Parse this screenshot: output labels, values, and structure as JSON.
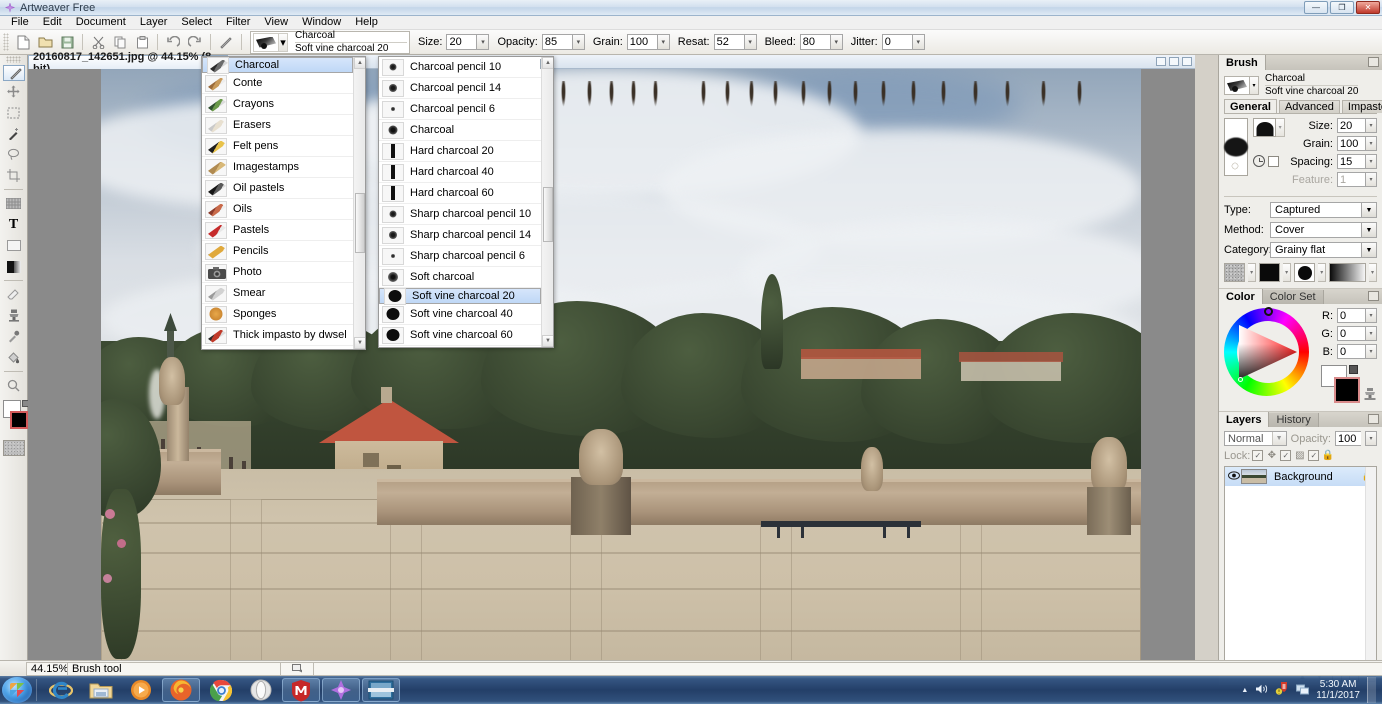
{
  "window": {
    "title": "Artweaver Free",
    "app_icon": "artweaver-icon",
    "minimize": "—",
    "maximize": "❐",
    "close": "✕"
  },
  "menubar": {
    "items": [
      "File",
      "Edit",
      "Document",
      "Layer",
      "Select",
      "Filter",
      "View",
      "Window",
      "Help"
    ]
  },
  "toolbar": {
    "buttons": [
      {
        "name": "new-document-button",
        "glyph": "🗋"
      },
      {
        "name": "open-document-button",
        "glyph": "🗁"
      },
      {
        "name": "save-document-button",
        "glyph": "🖫"
      },
      {
        "name": "cut-button",
        "glyph": "✂"
      },
      {
        "name": "copy-button",
        "glyph": "🗐"
      },
      {
        "name": "paste-button",
        "glyph": "📋"
      },
      {
        "name": "undo-button",
        "glyph": "↺"
      },
      {
        "name": "redo-button",
        "glyph": "↻"
      },
      {
        "name": "brush-tool-button",
        "glyph": "/"
      }
    ],
    "brush_preview": {
      "category": "Charcoal",
      "variant": "Soft vine charcoal 20"
    },
    "params": [
      {
        "label": "Size:",
        "value": "20",
        "name": "size-param"
      },
      {
        "label": "Opacity:",
        "value": "85",
        "name": "opacity-param"
      },
      {
        "label": "Grain:",
        "value": "100",
        "name": "grain-param"
      },
      {
        "label": "Resat:",
        "value": "52",
        "name": "resat-param"
      },
      {
        "label": "Bleed:",
        "value": "80",
        "name": "bleed-param"
      },
      {
        "label": "Jitter:",
        "value": "0",
        "name": "jitter-param"
      }
    ]
  },
  "tools": [
    {
      "name": "brush-tool",
      "glyph": "✎",
      "selected": true
    },
    {
      "name": "move-tool",
      "glyph": "✥"
    },
    {
      "name": "rectangular-marquee-tool",
      "glyph": "▢"
    },
    {
      "name": "magic-wand-tool",
      "glyph": "✦"
    },
    {
      "name": "lasso-tool",
      "glyph": "◌"
    },
    {
      "name": "crop-tool",
      "glyph": "⊞"
    },
    {
      "name": "gradient-tool",
      "glyph": "▤"
    },
    {
      "name": "text-tool",
      "glyph": "T"
    },
    {
      "name": "shape-tool",
      "glyph": "▭"
    },
    {
      "name": "fill-shape-tool",
      "glyph": "◧"
    },
    {
      "name": "eraser-tool",
      "glyph": "⌫"
    },
    {
      "name": "clone-stamp-tool",
      "glyph": "♟"
    },
    {
      "name": "eyedropper-tool",
      "glyph": "⚲"
    },
    {
      "name": "paint-bucket-tool",
      "glyph": "◔"
    },
    {
      "name": "zoom-tool",
      "glyph": "⌕"
    },
    {
      "name": "hand-tool",
      "glyph": "✋"
    }
  ],
  "document": {
    "tab_title": "20160817_142651.jpg @ 44.15% (8-bit)",
    "close_glyph": "✕"
  },
  "brush_category_dropdown": {
    "items": [
      {
        "label": "Charcoal",
        "selected": true
      },
      {
        "label": "Conte",
        "selected": false
      },
      {
        "label": "Crayons",
        "selected": false
      },
      {
        "label": "Erasers",
        "selected": false
      },
      {
        "label": "Felt pens",
        "selected": false
      },
      {
        "label": "Imagestamps",
        "selected": false
      },
      {
        "label": "Oil pastels",
        "selected": false
      },
      {
        "label": "Oils",
        "selected": false
      },
      {
        "label": "Pastels",
        "selected": false
      },
      {
        "label": "Pencils",
        "selected": false
      },
      {
        "label": "Photo",
        "selected": false
      },
      {
        "label": "Smear",
        "selected": false
      },
      {
        "label": "Sponges",
        "selected": false
      },
      {
        "label": "Thick impasto by dwsel",
        "selected": false
      }
    ]
  },
  "brush_variant_dropdown": {
    "items": [
      {
        "label": "Charcoal pencil 10",
        "icon": "dot-8",
        "selected": false
      },
      {
        "label": "Charcoal pencil 14",
        "icon": "dot-8",
        "selected": false
      },
      {
        "label": "Charcoal pencil 6",
        "icon": "dot-4",
        "selected": false
      },
      {
        "label": "Charcoal",
        "icon": "dot-9",
        "selected": false
      },
      {
        "label": "Hard charcoal 20",
        "icon": "bar",
        "selected": false
      },
      {
        "label": "Hard charcoal 40",
        "icon": "bar",
        "selected": false
      },
      {
        "label": "Hard charcoal 60",
        "icon": "bar",
        "selected": false
      },
      {
        "label": "Sharp charcoal pencil 10",
        "icon": "dot-8",
        "selected": false
      },
      {
        "label": "Sharp charcoal pencil 14",
        "icon": "dot-8",
        "selected": false
      },
      {
        "label": "Sharp charcoal pencil 6",
        "icon": "dot-4",
        "selected": false
      },
      {
        "label": "Soft charcoal",
        "icon": "dot-10",
        "selected": false
      },
      {
        "label": "Soft vine charcoal 20",
        "icon": "dot-14",
        "selected": true
      },
      {
        "label": "Soft vine charcoal 40",
        "icon": "dot-14",
        "selected": false
      },
      {
        "label": "Soft vine charcoal 60",
        "icon": "dot-14",
        "selected": false
      }
    ]
  },
  "brush_panel": {
    "tab_label": "Brush",
    "category": "Charcoal",
    "variant": "Soft vine charcoal 20",
    "subtabs": [
      {
        "label": "General",
        "active": true
      },
      {
        "label": "Advanced",
        "active": false
      },
      {
        "label": "Impasto",
        "active": false
      }
    ],
    "fields": [
      {
        "label": "Size:",
        "value": "20",
        "disabled": false,
        "name": "brush-size-field"
      },
      {
        "label": "Grain:",
        "value": "100",
        "disabled": false,
        "name": "brush-grain-field"
      },
      {
        "label": "Spacing:",
        "value": "15",
        "disabled": false,
        "name": "brush-spacing-field"
      },
      {
        "label": "Feature:",
        "value": "1",
        "disabled": true,
        "name": "brush-feature-field"
      }
    ],
    "selects": [
      {
        "label": "Type:",
        "value": "Captured",
        "name": "brush-type-select"
      },
      {
        "label": "Method:",
        "value": "Cover",
        "name": "brush-method-select"
      },
      {
        "label": "Category:",
        "value": "Grainy flat",
        "name": "brush-category-select"
      }
    ],
    "textures": [
      "paper-texture",
      "pattern-texture",
      "brush-tip-texture",
      "gradient-texture"
    ]
  },
  "color_panel": {
    "tabs": [
      {
        "label": "Color",
        "active": true
      },
      {
        "label": "Color Set",
        "active": false
      }
    ],
    "channels": [
      {
        "label": "R:",
        "value": "0",
        "name": "red-channel-field"
      },
      {
        "label": "G:",
        "value": "0",
        "name": "green-channel-field"
      },
      {
        "label": "B:",
        "value": "0",
        "name": "blue-channel-field"
      }
    ],
    "foreground_color": "#ffffff",
    "background_color": "#000000"
  },
  "layers_panel": {
    "tabs": [
      {
        "label": "Layers",
        "active": true
      },
      {
        "label": "History",
        "active": false
      }
    ],
    "blend_mode": "Normal",
    "opacity_label": "Opacity:",
    "opacity_value": "100",
    "lock_label": "Lock:",
    "layers": [
      {
        "name": "Background",
        "visible": true,
        "locked": true
      }
    ],
    "buttons": [
      {
        "name": "move-layer-up-button",
        "glyph": "▲"
      },
      {
        "name": "move-layer-down-button",
        "glyph": "▼"
      },
      {
        "name": "new-layer-button",
        "glyph": "🗋"
      },
      {
        "name": "duplicate-layer-button",
        "glyph": "🗎"
      },
      {
        "name": "delete-layer-button",
        "glyph": "🗑"
      }
    ]
  },
  "statusbar": {
    "zoom": "44.15%",
    "tool": "Brush tool"
  },
  "taskbar": {
    "start_label": "Start",
    "apps": [
      {
        "name": "internet-explorer-icon",
        "open": false
      },
      {
        "name": "file-explorer-icon",
        "open": false
      },
      {
        "name": "windows-media-player-icon",
        "open": false
      },
      {
        "name": "firefox-icon",
        "open": true
      },
      {
        "name": "google-chrome-icon",
        "open": false
      },
      {
        "name": "opera-icon",
        "open": false
      },
      {
        "name": "mcafee-icon",
        "open": true
      },
      {
        "name": "artweaver-icon",
        "open": true
      },
      {
        "name": "image-viewer-icon",
        "open": true
      }
    ],
    "tray": [
      {
        "name": "show-hidden-icons-icon",
        "glyph": "▲"
      },
      {
        "name": "volume-icon",
        "glyph": "🔊"
      },
      {
        "name": "antivirus-alert-icon",
        "glyph": "🛡"
      },
      {
        "name": "network-icon",
        "glyph": "🖧"
      }
    ],
    "clock_time": "5:30 AM",
    "clock_date": "11/1/2017"
  }
}
